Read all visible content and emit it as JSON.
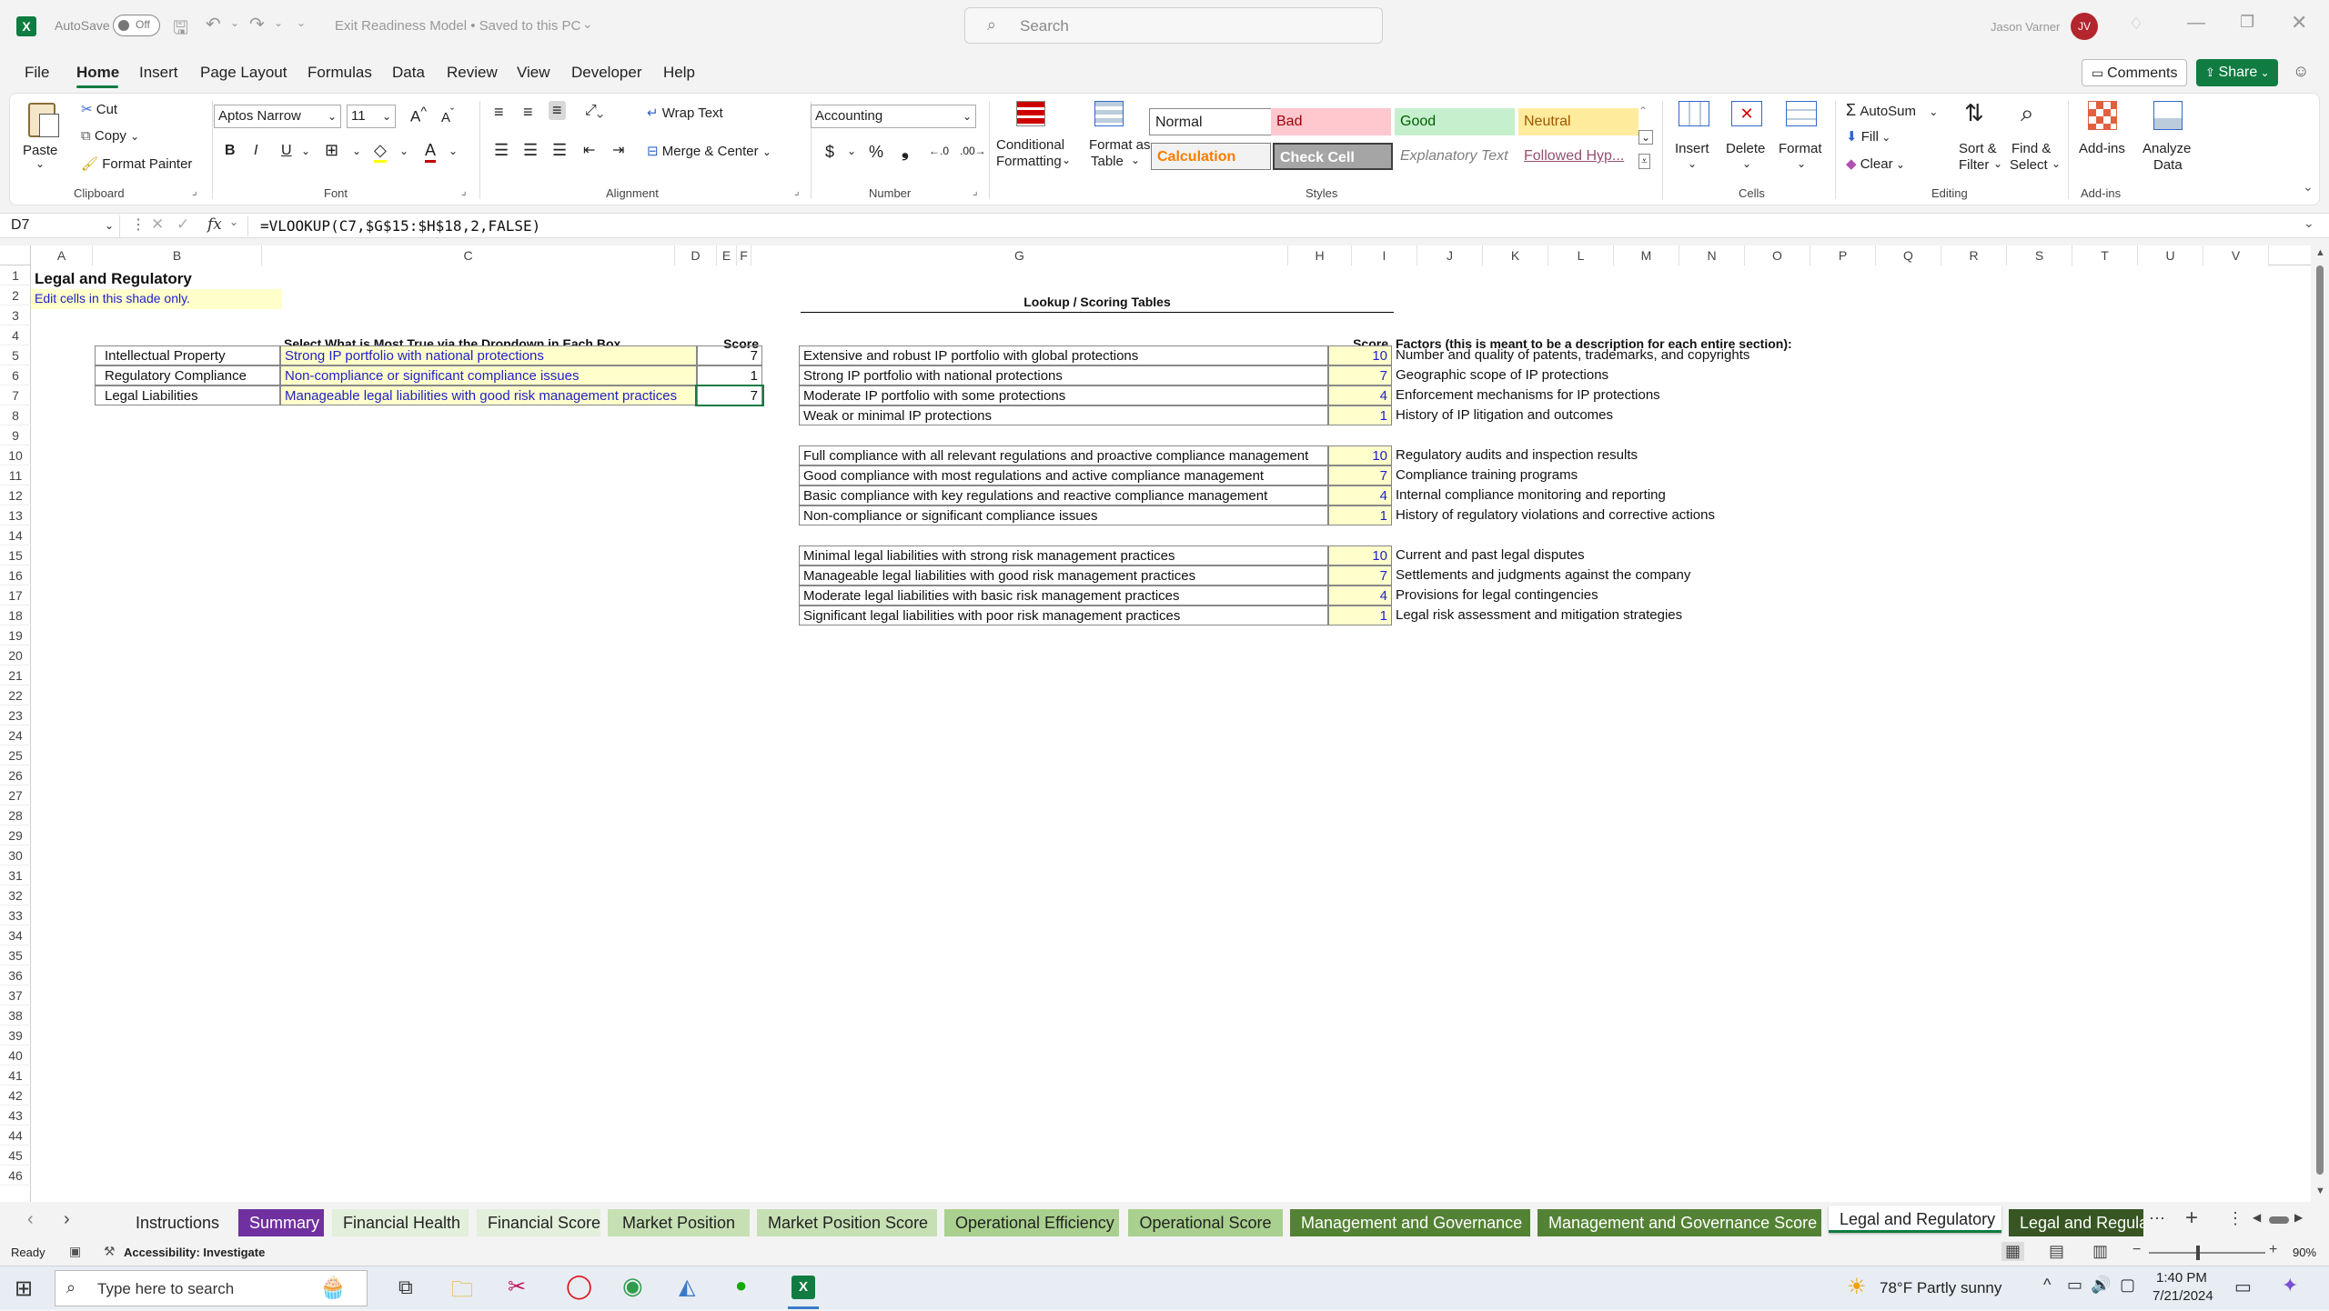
{
  "app": {
    "autosave_label": "AutoSave",
    "autosave_state": "Off",
    "doc_title": "Exit Readiness Model • Saved to this PC",
    "search_placeholder": "Search",
    "user_name": "Jason Varner",
    "user_initials": "JV"
  },
  "menu": [
    "File",
    "Home",
    "Insert",
    "Page Layout",
    "Formulas",
    "Data",
    "Review",
    "View",
    "Developer",
    "Help"
  ],
  "menu_right": {
    "comments": "Comments",
    "share": "Share"
  },
  "ribbon": {
    "clipboard": {
      "label": "Clipboard",
      "paste": "Paste",
      "cut": "Cut",
      "copy": "Copy",
      "format_painter": "Format Painter"
    },
    "font": {
      "label": "Font",
      "name": "Aptos Narrow",
      "size": "11"
    },
    "alignment": {
      "label": "Alignment",
      "wrap": "Wrap Text",
      "merge": "Merge & Center"
    },
    "number": {
      "label": "Number",
      "format": "Accounting"
    },
    "styles": {
      "label": "Styles",
      "cond_fmt_1": "Conditional",
      "cond_fmt_2": "Formatting",
      "fmt_table_1": "Format as",
      "fmt_table_2": "Table",
      "normal": "Normal",
      "bad": "Bad",
      "good": "Good",
      "neutral": "Neutral",
      "calculation": "Calculation",
      "check_cell": "Check Cell",
      "explanatory": "Explanatory Text",
      "followed": "Followed Hyp..."
    },
    "cells": {
      "label": "Cells",
      "insert": "Insert",
      "delete": "Delete",
      "format": "Format"
    },
    "editing": {
      "label": "Editing",
      "autosum": "AutoSum",
      "fill": "Fill",
      "clear": "Clear",
      "sort_1": "Sort &",
      "sort_2": "Filter",
      "find_1": "Find &",
      "find_2": "Select"
    },
    "addins": {
      "label": "Add-ins",
      "addins": "Add-ins",
      "analyze_1": "Analyze",
      "analyze_2": "Data"
    }
  },
  "formula": {
    "name_box": "D7",
    "fx": "fx",
    "text": "=VLOOKUP(C7,$G$15:$H$18,2,FALSE)"
  },
  "columns": [
    "A",
    "B",
    "C",
    "D",
    "E",
    "F",
    "G",
    "H",
    "I",
    "J",
    "K",
    "L",
    "M",
    "N",
    "O",
    "P",
    "Q",
    "R",
    "S",
    "T",
    "U",
    "V"
  ],
  "rows": [
    "1",
    "2",
    "3",
    "4",
    "5",
    "6",
    "7",
    "8",
    "9",
    "10",
    "11",
    "12",
    "13",
    "14",
    "15",
    "16",
    "17",
    "18",
    "19",
    "20",
    "21",
    "22",
    "23",
    "24",
    "25",
    "26",
    "27",
    "28",
    "29",
    "30",
    "31",
    "32",
    "33",
    "34",
    "35",
    "36",
    "37",
    "38",
    "39",
    "40",
    "41",
    "42",
    "43",
    "44",
    "45",
    "46"
  ],
  "sheet": {
    "title": "Legal and Regulatory",
    "edit_note": "Edit cells in this shade only.",
    "select_header": "Select What is Most True via the Dropdown in Each Box",
    "score_header": "Score",
    "inputs": [
      {
        "category": "Intellectual Property",
        "selection": "Strong IP portfolio with national protections",
        "score": "7"
      },
      {
        "category": "Regulatory Compliance",
        "selection": "Non-compliance or significant compliance issues",
        "score": "1"
      },
      {
        "category": "Legal Liabilities",
        "selection": "Manageable legal liabilities with good risk management practices",
        "score": "7"
      }
    ],
    "lookup_title": "Lookup  / Scoring Tables",
    "lookup_score_header": "Score",
    "factors_header": "Factors (this is meant to be a description for each entire section):",
    "lookup_groups": [
      {
        "rows": [
          {
            "desc": "Extensive and robust IP portfolio with global protections",
            "score": "10",
            "factor": "Number and quality of patents, trademarks, and copyrights"
          },
          {
            "desc": "Strong IP portfolio with national protections",
            "score": "7",
            "factor": "Geographic scope of IP protections"
          },
          {
            "desc": "Moderate IP portfolio with some protections",
            "score": "4",
            "factor": "Enforcement mechanisms for IP protections"
          },
          {
            "desc": "Weak or minimal IP protections",
            "score": "1",
            "factor": "History of IP litigation and outcomes"
          }
        ]
      },
      {
        "rows": [
          {
            "desc": "Full compliance with all relevant regulations and proactive compliance management",
            "score": "10",
            "factor": "Regulatory audits and inspection results"
          },
          {
            "desc": "Good compliance with most regulations and active compliance management",
            "score": "7",
            "factor": "Compliance training programs"
          },
          {
            "desc": "Basic compliance with key regulations and reactive compliance management",
            "score": "4",
            "factor": "Internal compliance monitoring and reporting"
          },
          {
            "desc": "Non-compliance or significant compliance issues",
            "score": "1",
            "factor": "History of regulatory violations and corrective actions"
          }
        ]
      },
      {
        "rows": [
          {
            "desc": "Minimal legal liabilities with strong risk management practices",
            "score": "10",
            "factor": "Current and past legal disputes"
          },
          {
            "desc": "Manageable legal liabilities with good risk management practices",
            "score": "7",
            "factor": "Settlements and judgments against the company"
          },
          {
            "desc": "Moderate legal liabilities with basic risk management practices",
            "score": "4",
            "factor": "Provisions for legal contingencies"
          },
          {
            "desc": "Significant legal liabilities with poor risk management practices",
            "score": "1",
            "factor": "Legal risk assessment and mitigation strategies"
          }
        ]
      }
    ]
  },
  "tabs": [
    {
      "label": "Instructions",
      "bg": "#f3f3f3",
      "fg": "#222"
    },
    {
      "label": "Summary",
      "bg": "#7030a0",
      "fg": "#ffffff"
    },
    {
      "label": "Financial Health",
      "bg": "#e2efda",
      "fg": "#222"
    },
    {
      "label": "Financial Score",
      "bg": "#e2efda",
      "fg": "#222"
    },
    {
      "label": "Market Position",
      "bg": "#c6e0b4",
      "fg": "#222"
    },
    {
      "label": "Market Position Score",
      "bg": "#c6e0b4",
      "fg": "#222"
    },
    {
      "label": "Operational Efficiency",
      "bg": "#a9d08e",
      "fg": "#222"
    },
    {
      "label": "Operational Score",
      "bg": "#a9d08e",
      "fg": "#222"
    },
    {
      "label": "Management and Governance",
      "bg": "#548235",
      "fg": "#ffffff"
    },
    {
      "label": "Management and Governance Score",
      "bg": "#548235",
      "fg": "#ffffff"
    },
    {
      "label": "Legal and Regulatory",
      "bg": "#ffffff",
      "fg": "#222"
    },
    {
      "label": "Legal and Regula",
      "bg": "#375623",
      "fg": "#ffffff"
    }
  ],
  "status": {
    "ready": "Ready",
    "accessibility": "Accessibility: Investigate",
    "zoom": "90%"
  },
  "taskbar": {
    "search_placeholder": "Type here to search",
    "weather": "78°F  Partly sunny",
    "time": "1:40 PM",
    "date": "7/21/2024"
  }
}
